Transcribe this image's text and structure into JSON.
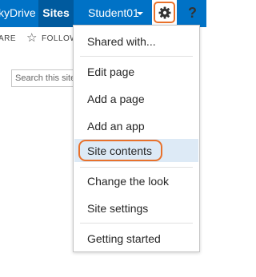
{
  "suitebar": {
    "skydrive_label": "kyDrive",
    "sites_label": "Sites",
    "user_label": "Student01",
    "help_label": "?",
    "colors": {
      "bar": "#0072c6",
      "active": "#005a9e",
      "highlight_ring": "#e8712b"
    },
    "icons": {
      "gear": "gear-icon",
      "caret": "chevron-down-icon",
      "help": "help-icon"
    }
  },
  "ribbon": {
    "share_label": "ARE",
    "follow_label": "FOLLOW",
    "icons": {
      "follow": "star-icon",
      "focus": "focus-on-content-icon"
    }
  },
  "search": {
    "placeholder": "Search this site"
  },
  "settings_menu": {
    "items": [
      {
        "label": "Shared with..."
      },
      {
        "label": "Edit page"
      },
      {
        "label": "Add a page"
      },
      {
        "label": "Add an app"
      },
      {
        "label": "Site contents",
        "highlighted": true
      },
      {
        "label": "Change the look"
      },
      {
        "label": "Site settings"
      },
      {
        "label": "Getting started"
      }
    ],
    "colors": {
      "hover": "#ddeaf6",
      "highlight_ring": "#e8712b"
    }
  }
}
